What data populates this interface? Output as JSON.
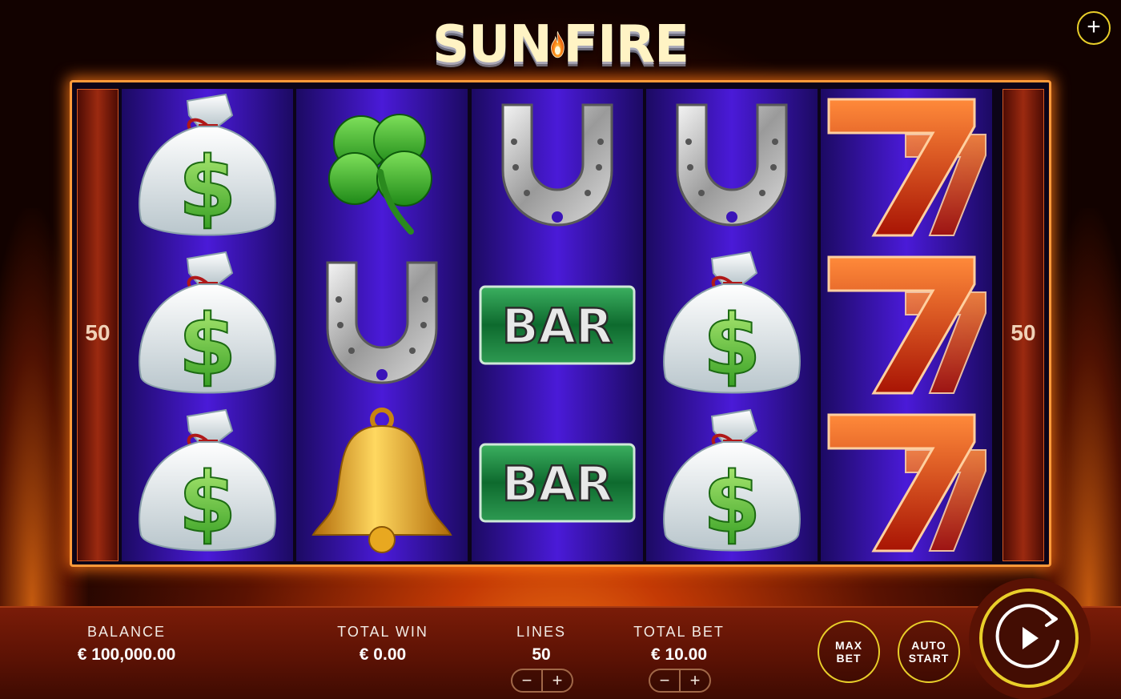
{
  "game": {
    "title_part1": "SUN",
    "title_part2": "FIRE"
  },
  "header": {
    "menu_icon": "plus-icon"
  },
  "paylines": {
    "left": "50",
    "right": "50"
  },
  "reels": [
    [
      "money-bag",
      "money-bag",
      "money-bag"
    ],
    [
      "clover",
      "horseshoe",
      "bell"
    ],
    [
      "horseshoe",
      "bar",
      "bar"
    ],
    [
      "horseshoe",
      "money-bag",
      "money-bag"
    ],
    [
      "seven",
      "seven",
      "seven"
    ]
  ],
  "symbol_text": {
    "bar": "BAR"
  },
  "stats": {
    "balance_label": "BALANCE",
    "balance_value": "€ 100,000.00",
    "win_label": "TOTAL WIN",
    "win_value": "€ 0.00",
    "lines_label": "LINES",
    "lines_value": "50",
    "bet_label": "TOTAL BET",
    "bet_value": "€ 10.00"
  },
  "stepper": {
    "minus": "−",
    "plus": "+"
  },
  "buttons": {
    "max_bet_line1": "MAX",
    "max_bet_line2": "BET",
    "auto_start_line1": "AUTO",
    "auto_start_line2": "START",
    "spin_icon": "play-icon"
  },
  "colors": {
    "accent": "#e9cf2a",
    "reel": "#3a14b8",
    "frame": "#ff9a3a"
  }
}
